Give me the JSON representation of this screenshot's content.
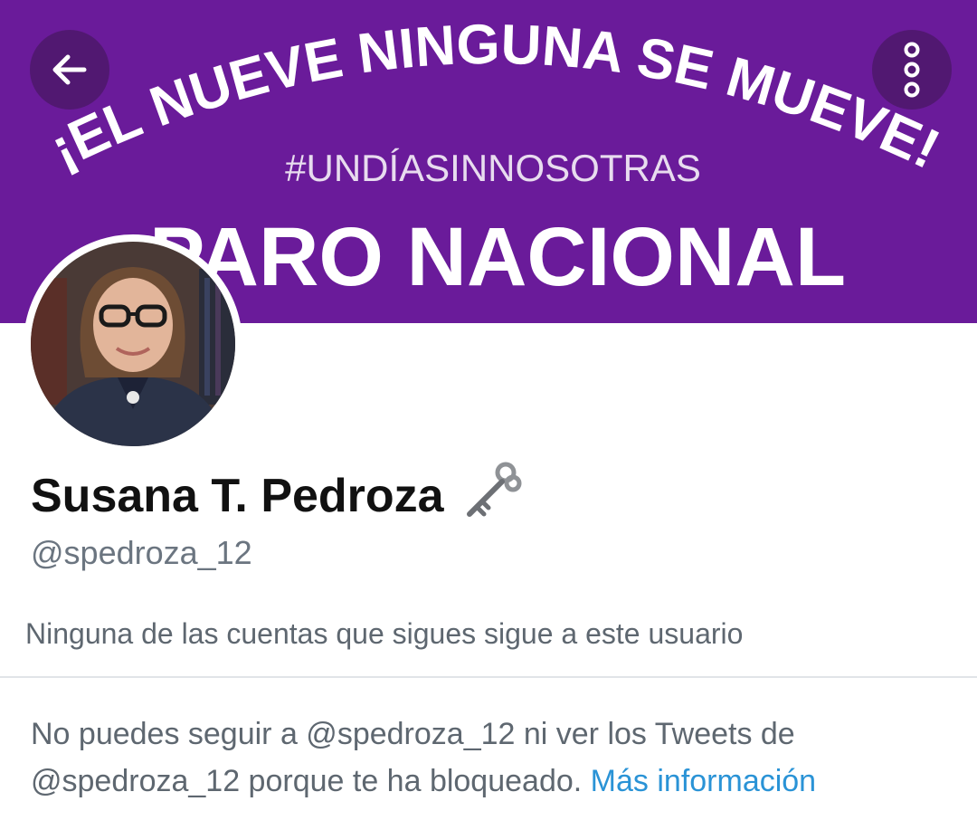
{
  "header": {
    "banner": {
      "line1": "¡EL NUEVE NINGUNA SE MUEVE!",
      "hashtag": "#UNDÍASINNOSOTRAS",
      "headline": "PARO NACIONAL",
      "background_color": "#6a1b9a"
    },
    "back_icon": "arrow-left",
    "more_icon": "vertical-dots"
  },
  "profile": {
    "name": "Susana T. Pedroza",
    "name_emoji": "key",
    "handle": "@spedroza_12",
    "follow_info": "Ninguna de las cuentas que sigues sigue a este usuario"
  },
  "blocked": {
    "message": "No puedes seguir a @spedroza_12 ni ver los Tweets de @spedroza_12 porque te ha bloqueado.",
    "learn_more": "Más información",
    "link_color": "#2a93d6"
  }
}
